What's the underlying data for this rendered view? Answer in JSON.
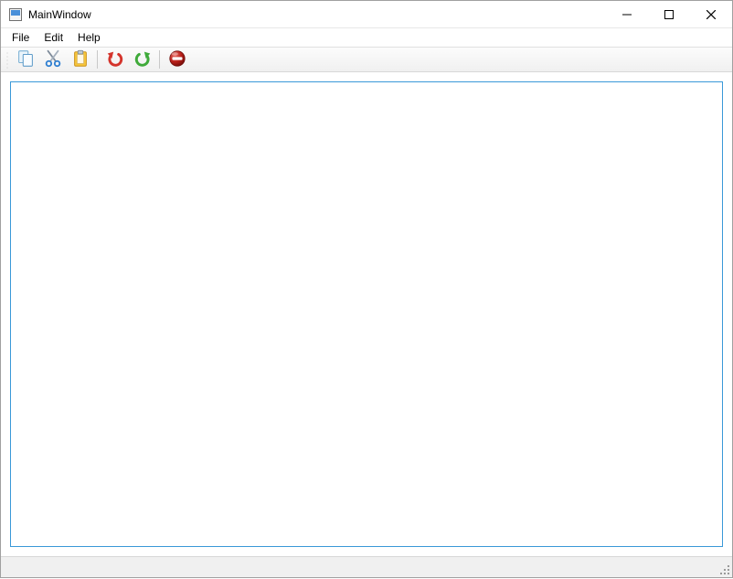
{
  "window": {
    "title": "MainWindow"
  },
  "menubar": {
    "file": "File",
    "edit": "Edit",
    "help": "Help"
  },
  "editor": {
    "value": ""
  }
}
